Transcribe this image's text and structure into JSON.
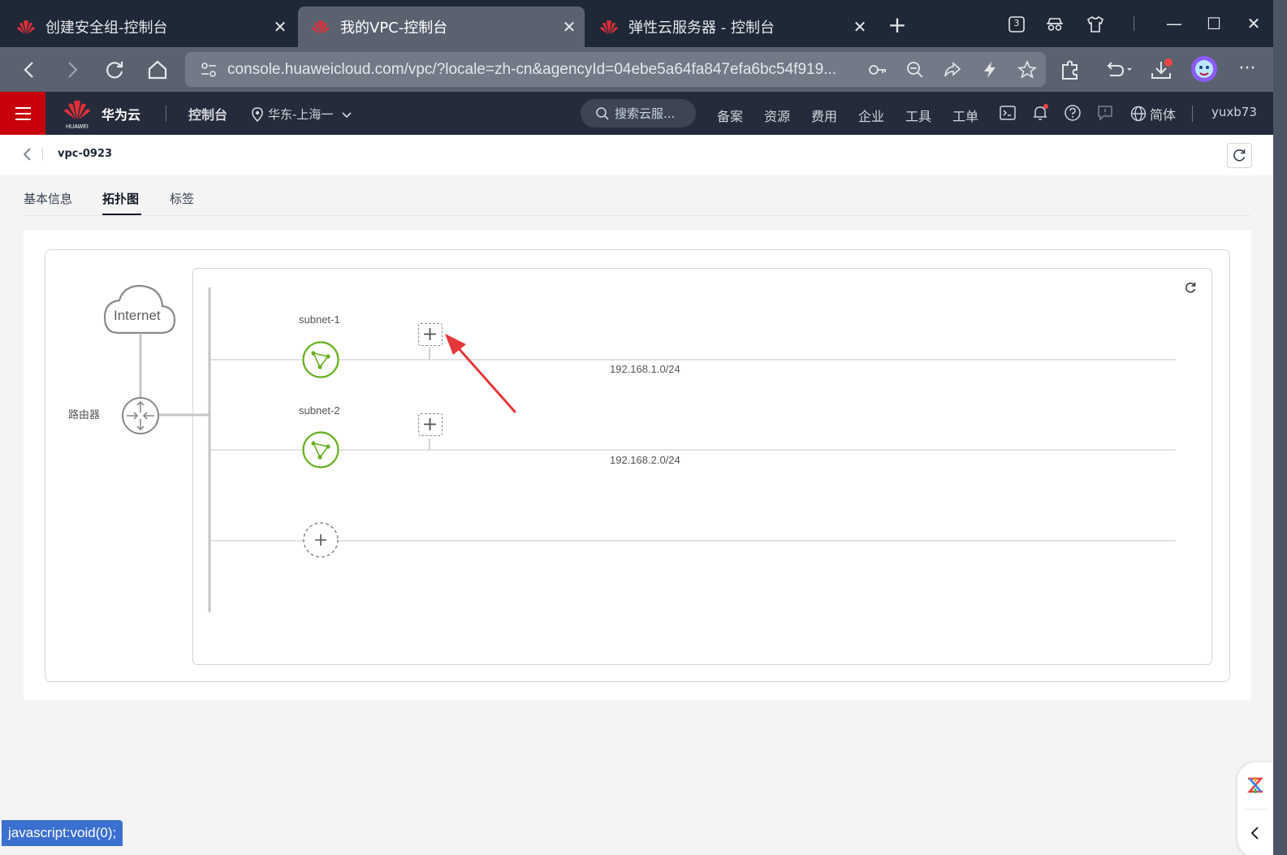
{
  "browser": {
    "tabs": [
      {
        "title": "创建安全组-控制台",
        "active": false
      },
      {
        "title": "我的VPC-控制台",
        "active": true
      },
      {
        "title": "弹性云服务器 - 控制台",
        "active": false
      }
    ],
    "tab_count_badge": "3",
    "url": "console.huaweicloud.com/vpc/?locale=zh-cn&agencyId=04ebe5a64fa847efa6bc54f919...",
    "status_text": "javascript:void(0);"
  },
  "console": {
    "brand": "华为云",
    "logo_text": "HUAWEI",
    "title": "控制台",
    "region": "华东-上海一",
    "search_placeholder": "搜索云服...",
    "nav": [
      "备案",
      "资源",
      "费用",
      "企业",
      "工具",
      "工单"
    ],
    "language": "简体",
    "user": "yuxb73"
  },
  "page": {
    "vpc_name": "vpc-0923",
    "tabs": [
      {
        "label": "基本信息",
        "active": false
      },
      {
        "label": "拓扑图",
        "active": true
      },
      {
        "label": "标签",
        "active": false
      }
    ]
  },
  "topology": {
    "internet_label": "Internet",
    "router_label": "路由器",
    "subnets": [
      {
        "name": "subnet-1",
        "cidr": "192.168.1.0/24"
      },
      {
        "name": "subnet-2",
        "cidr": "192.168.2.0/24"
      }
    ]
  },
  "colors": {
    "brand_red": "#c7000b",
    "subnet_green": "#67b121",
    "annotation_arrow": "#e5373a",
    "status_blue": "#3b6fd0"
  }
}
